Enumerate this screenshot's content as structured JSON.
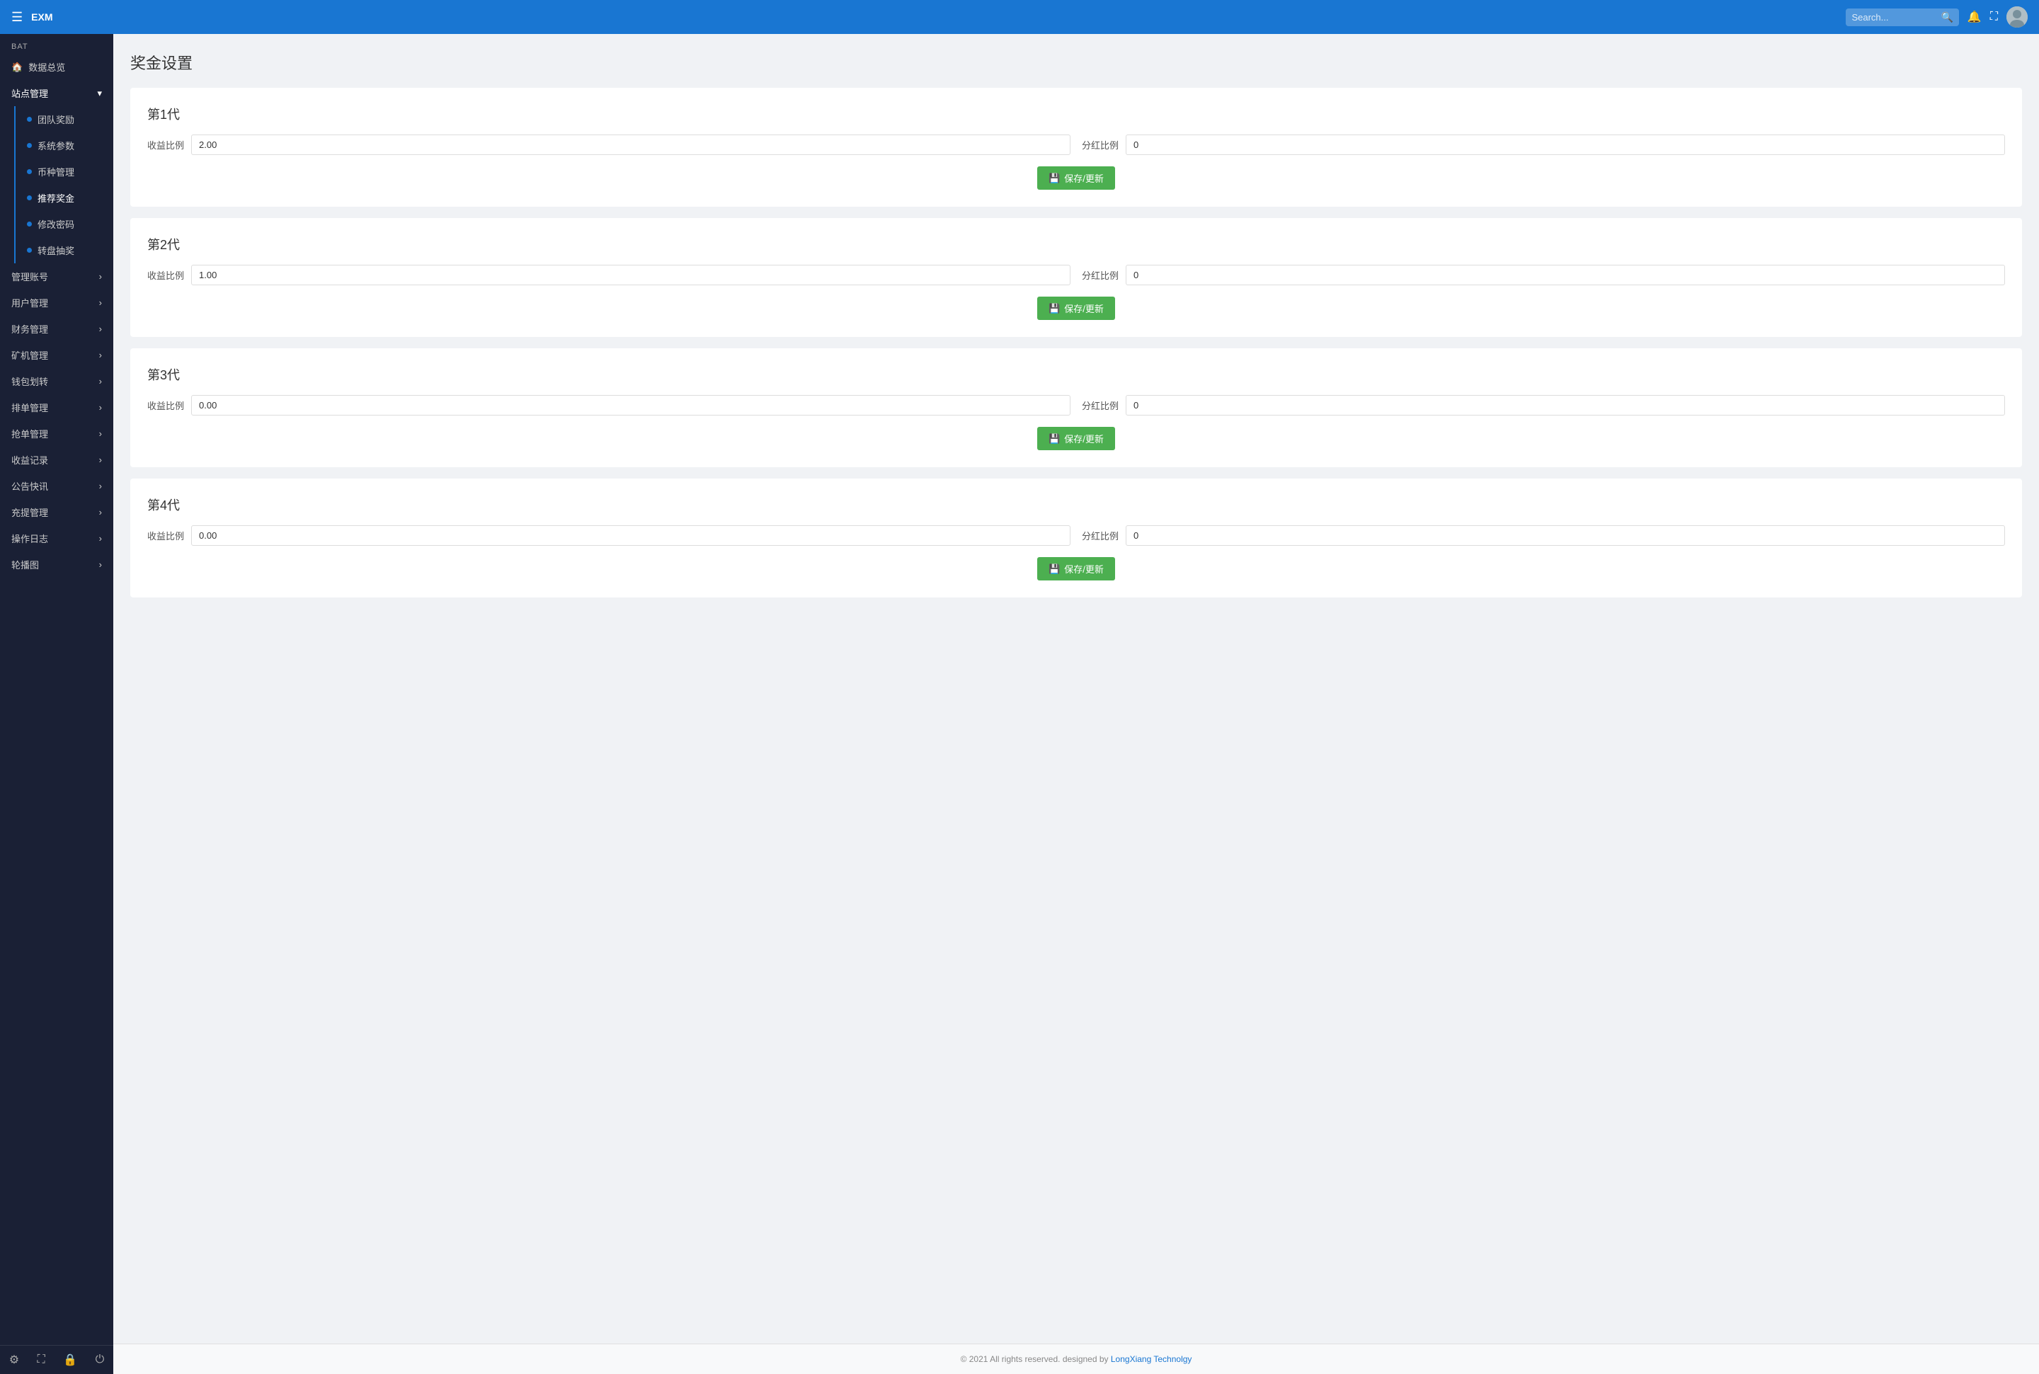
{
  "app": {
    "logo": "EXM"
  },
  "topnav": {
    "search_placeholder": "Search...",
    "search_value": ""
  },
  "sidebar": {
    "section_title": "BAT",
    "home_label": "数据总览",
    "group1": {
      "title": "站点管理",
      "expanded": true,
      "items": [
        {
          "label": "团队奖励"
        },
        {
          "label": "系统参数"
        },
        {
          "label": "币种管理"
        },
        {
          "label": "推荐奖金"
        },
        {
          "label": "修改密码"
        },
        {
          "label": "转盘抽奖"
        }
      ]
    },
    "groups": [
      {
        "label": "管理账号",
        "has_arrow": true
      },
      {
        "label": "用户管理",
        "has_arrow": true
      },
      {
        "label": "财务管理",
        "has_arrow": true
      },
      {
        "label": "矿机管理",
        "has_arrow": true
      },
      {
        "label": "钱包划转",
        "has_arrow": true
      },
      {
        "label": "排单管理",
        "has_arrow": true
      },
      {
        "label": "抢单管理",
        "has_arrow": true
      },
      {
        "label": "收益记录",
        "has_arrow": true
      },
      {
        "label": "公告快讯",
        "has_arrow": true
      },
      {
        "label": "充提管理",
        "has_arrow": true
      },
      {
        "label": "操作日志",
        "has_arrow": true
      },
      {
        "label": "轮播图",
        "has_arrow": true
      }
    ],
    "bottom_icons": [
      "gear-icon",
      "fullscreen-icon",
      "lock-icon",
      "power-icon"
    ]
  },
  "page": {
    "title": "奖金设置",
    "generations": [
      {
        "title": "第1代",
        "income_label": "收益比例",
        "income_value": "2.00",
        "dividend_label": "分红比例",
        "dividend_value": "0",
        "save_label": "保存/更新"
      },
      {
        "title": "第2代",
        "income_label": "收益比例",
        "income_value": "1.00",
        "dividend_label": "分红比例",
        "dividend_value": "0",
        "save_label": "保存/更新"
      },
      {
        "title": "第3代",
        "income_label": "收益比例",
        "income_value": "0.00",
        "dividend_label": "分红比例",
        "dividend_value": "0",
        "save_label": "保存/更新"
      },
      {
        "title": "第4代",
        "income_label": "收益比例",
        "income_value": "0.00",
        "dividend_label": "分红比例",
        "dividend_value": "0",
        "save_label": "保存/更新"
      }
    ]
  },
  "footer": {
    "text": "© 2021 All rights reserved. designed by ",
    "link_text": "LongXiang Technolgy",
    "link_url": "#"
  }
}
